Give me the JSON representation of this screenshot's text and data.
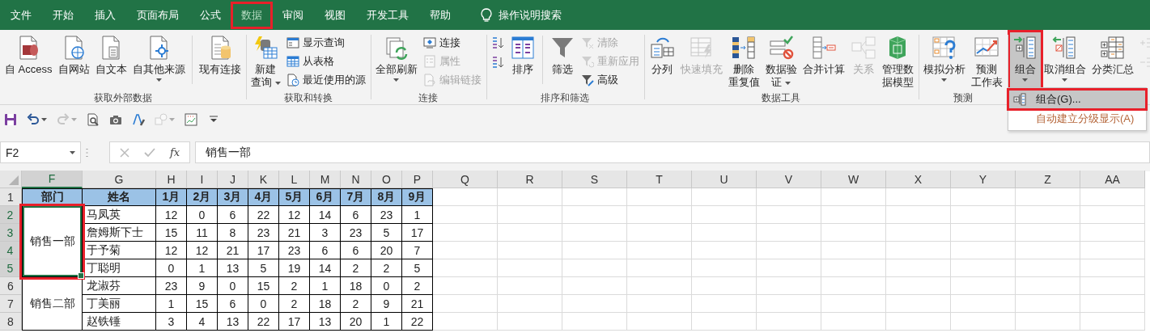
{
  "tabs": [
    {
      "label": "文件",
      "selected": false,
      "annotated": false
    },
    {
      "label": "开始",
      "selected": false,
      "annotated": false
    },
    {
      "label": "插入",
      "selected": false,
      "annotated": false
    },
    {
      "label": "页面布局",
      "selected": false,
      "annotated": false
    },
    {
      "label": "公式",
      "selected": false,
      "annotated": false
    },
    {
      "label": "数据",
      "selected": true,
      "annotated": true
    },
    {
      "label": "审阅",
      "selected": false,
      "annotated": false
    },
    {
      "label": "视图",
      "selected": false,
      "annotated": false
    },
    {
      "label": "开发工具",
      "selected": false,
      "annotated": false
    },
    {
      "label": "帮助",
      "selected": false,
      "annotated": false
    }
  ],
  "tell_me": {
    "label": "操作说明搜索"
  },
  "ribbon": {
    "groups": [
      {
        "label": "获取外部数据",
        "items": [
          {
            "kind": "large",
            "label": "自 Access"
          },
          {
            "kind": "large",
            "label": "自网站"
          },
          {
            "kind": "large",
            "label": "自文本"
          },
          {
            "kind": "large",
            "label": "自其他来源",
            "dropdown": true
          },
          {
            "kind": "separator"
          },
          {
            "kind": "large",
            "label": "现有连接"
          }
        ]
      },
      {
        "label": "获取和转换",
        "items": [
          {
            "kind": "large",
            "lines": [
              "新建",
              "查询"
            ],
            "dropdown": true
          },
          {
            "kind": "stack",
            "items": [
              {
                "label": "显示查询",
                "disabled": false
              },
              {
                "label": "从表格",
                "disabled": false
              },
              {
                "label": "最近使用的源",
                "disabled": false
              }
            ]
          }
        ]
      },
      {
        "label": "连接",
        "items": [
          {
            "kind": "large",
            "label": "全部刷新",
            "dropdown": true
          },
          {
            "kind": "stack",
            "items": [
              {
                "label": "连接",
                "disabled": false
              },
              {
                "label": "属性",
                "disabled": true
              },
              {
                "label": "编辑链接",
                "disabled": true
              }
            ]
          }
        ]
      },
      {
        "label": "排序和筛选",
        "items": [
          {
            "kind": "stack",
            "items": [
              {
                "disabled": false
              },
              {
                "disabled": false
              }
            ]
          },
          {
            "kind": "large",
            "label": "排序"
          },
          {
            "kind": "separator"
          },
          {
            "kind": "large",
            "label": "筛选"
          },
          {
            "kind": "stack",
            "items": [
              {
                "label": "清除",
                "disabled": true
              },
              {
                "label": "重新应用",
                "disabled": true
              },
              {
                "label": "高级",
                "disabled": false
              }
            ]
          }
        ]
      },
      {
        "label": "数据工具",
        "items": [
          {
            "kind": "large",
            "label": "分列",
            "disabled": false
          },
          {
            "kind": "large",
            "label": "快速填充",
            "disabled": true
          },
          {
            "kind": "large",
            "lines": [
              "删除",
              "重复值"
            ],
            "disabled": false
          },
          {
            "kind": "large",
            "lines": [
              "数据验",
              "证"
            ],
            "dropdown": true,
            "disabled": false
          },
          {
            "kind": "large",
            "label": "合并计算",
            "disabled": false
          },
          {
            "kind": "large",
            "label": "关系",
            "disabled": true
          },
          {
            "kind": "large",
            "lines": [
              "管理数",
              "据模型"
            ],
            "disabled": false
          }
        ]
      },
      {
        "label": "预测",
        "items": [
          {
            "kind": "large",
            "label": "模拟分析",
            "dropdown": true
          },
          {
            "kind": "large",
            "lines": [
              "预测",
              "工作表"
            ]
          }
        ]
      },
      {
        "items": [
          {
            "kind": "large",
            "label": "组合",
            "dropdown": true,
            "pressed": true,
            "annotated": true
          },
          {
            "kind": "large",
            "label": "取消组合",
            "dropdown": true,
            "pressed": false,
            "annotated": false
          },
          {
            "kind": "large",
            "label": "分类汇总",
            "pressed": false,
            "annotated": false
          },
          {
            "kind": "stack",
            "items": [
              {
                "disabled": true
              },
              {
                "disabled": true
              }
            ]
          }
        ]
      }
    ]
  },
  "menu": {
    "items": [
      {
        "label": "组合(G)...",
        "selected": true,
        "annotated": true
      },
      {
        "label": "自动建立分级显示(A)",
        "selected": false,
        "annotated": false
      }
    ]
  },
  "quick_access": [
    {
      "disabled": false,
      "dropdown": false
    },
    {
      "dropdown": true,
      "disabled": false
    },
    {
      "dropdown": true,
      "disabled": true
    },
    {
      "disabled": false,
      "dropdown": false
    },
    {
      "disabled": false,
      "dropdown": false
    },
    {
      "disabled": false,
      "dropdown": false
    },
    {
      "dropdown": true,
      "disabled": true
    },
    {
      "disabled": false,
      "dropdown": false
    },
    {
      "disabled": false,
      "dropdown": false
    }
  ],
  "formula_bar": {
    "name_box": "F2",
    "function_label": "fx",
    "formula": "销售一部"
  },
  "sheet": {
    "columns": [
      {
        "label": "F",
        "selected": true
      },
      {
        "label": "G",
        "selected": false
      },
      {
        "label": "H",
        "selected": false
      },
      {
        "label": "I",
        "selected": false
      },
      {
        "label": "J",
        "selected": false
      },
      {
        "label": "K",
        "selected": false
      },
      {
        "label": "L",
        "selected": false
      },
      {
        "label": "M",
        "selected": false
      },
      {
        "label": "N",
        "selected": false
      },
      {
        "label": "O",
        "selected": false
      },
      {
        "label": "P",
        "selected": false
      },
      {
        "label": "Q",
        "selected": false
      },
      {
        "label": "R",
        "selected": false
      },
      {
        "label": "S",
        "selected": false
      },
      {
        "label": "T",
        "selected": false
      },
      {
        "label": "U",
        "selected": false
      },
      {
        "label": "V",
        "selected": false
      },
      {
        "label": "W",
        "selected": false
      },
      {
        "label": "X",
        "selected": false
      },
      {
        "label": "Y",
        "selected": false
      },
      {
        "label": "Z",
        "selected": false
      },
      {
        "label": "AA",
        "selected": false
      }
    ],
    "rows": [
      {
        "label": "1",
        "selected": false
      },
      {
        "label": "2",
        "selected": true
      },
      {
        "label": "3",
        "selected": true
      },
      {
        "label": "4",
        "selected": true
      },
      {
        "label": "5",
        "selected": true
      },
      {
        "label": "6",
        "selected": false
      },
      {
        "label": "7",
        "selected": false
      },
      {
        "label": "8",
        "selected": false
      }
    ],
    "header": [
      "部门",
      "姓名",
      "1月",
      "2月",
      "3月",
      "4月",
      "5月",
      "6月",
      "7月",
      "8月",
      "9月"
    ],
    "departments": [
      {
        "name": "销售一部",
        "selected": true,
        "annotated": true,
        "people": [
          {
            "name": "马凤英",
            "values": [
              "12",
              "0",
              "6",
              "22",
              "12",
              "14",
              "6",
              "23",
              "1"
            ]
          },
          {
            "name": "詹姆斯下士",
            "values": [
              "15",
              "11",
              "8",
              "23",
              "21",
              "3",
              "23",
              "5",
              "17"
            ]
          },
          {
            "name": "于予菊",
            "values": [
              "12",
              "12",
              "21",
              "17",
              "23",
              "6",
              "6",
              "20",
              "7"
            ]
          },
          {
            "name": "丁聪明",
            "values": [
              "0",
              "1",
              "13",
              "5",
              "19",
              "14",
              "2",
              "2",
              "5"
            ]
          }
        ]
      },
      {
        "name": "销售二部",
        "selected": false,
        "annotated": false,
        "people": [
          {
            "name": "龙淑芬",
            "values": [
              "23",
              "9",
              "0",
              "15",
              "2",
              "1",
              "18",
              "0",
              "2"
            ]
          },
          {
            "name": "丁美丽",
            "values": [
              "1",
              "15",
              "6",
              "0",
              "2",
              "18",
              "2",
              "9",
              "21"
            ]
          },
          {
            "name": "赵铁锤",
            "values": [
              "3",
              "4",
              "13",
              "22",
              "17",
              "13",
              "20",
              "1",
              "22"
            ]
          }
        ]
      }
    ]
  }
}
